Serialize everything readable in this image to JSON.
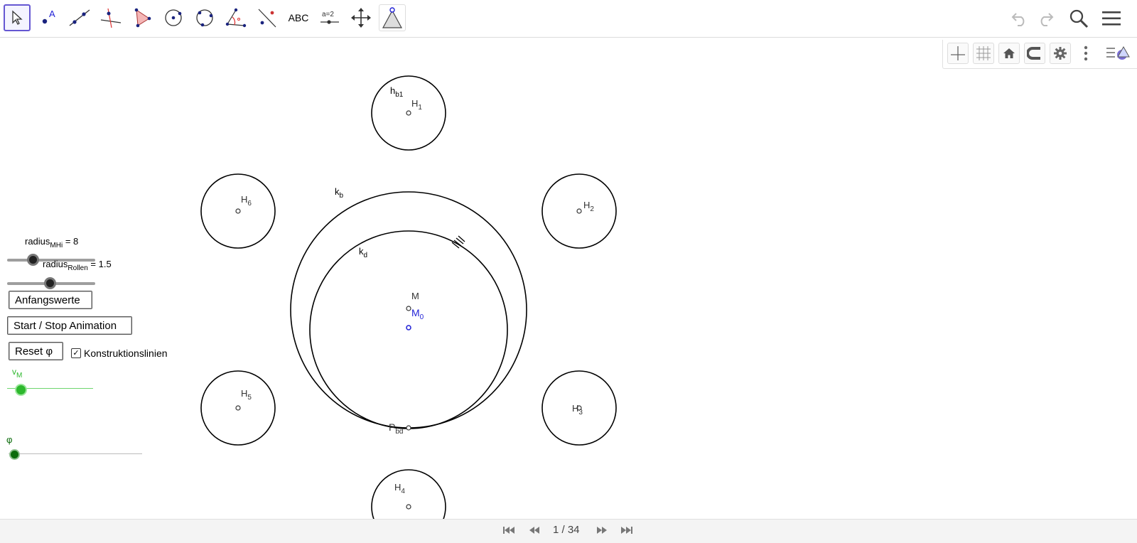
{
  "toolbar": {
    "tools": [
      {
        "name": "move-tool",
        "icon": "cursor-arrow-icon",
        "selected": true
      },
      {
        "name": "point-tool",
        "icon": "point-a-icon",
        "text": "A"
      },
      {
        "name": "line-tool",
        "icon": "line-through-points-icon"
      },
      {
        "name": "perpendicular-tool",
        "icon": "perpendicular-line-icon"
      },
      {
        "name": "polygon-tool",
        "icon": "polygon-icon"
      },
      {
        "name": "circle-center-tool",
        "icon": "circle-center-point-icon"
      },
      {
        "name": "circle-three-points-tool",
        "icon": "circle-three-points-icon"
      },
      {
        "name": "angle-tool",
        "icon": "angle-icon"
      },
      {
        "name": "reflect-tool",
        "icon": "reflect-about-line-icon"
      },
      {
        "name": "text-tool",
        "icon": "text-abc-icon",
        "text": "ABC"
      },
      {
        "name": "slider-tool",
        "icon": "slider-icon",
        "text": "a=2"
      },
      {
        "name": "move-graphics-tool",
        "icon": "move-graphics-icon"
      },
      {
        "name": "custom-tool",
        "icon": "triangle-tool-icon"
      }
    ],
    "right": [
      "undo-icon",
      "redo-icon",
      "search-icon",
      "menu-icon"
    ]
  },
  "graphics_bar": [
    "axes-icon",
    "grid-icon",
    "home-icon",
    "magnet-icon",
    "gear-icon",
    "more-vertical-icon",
    "style-bar-toggle-icon"
  ],
  "labels": {
    "hb1_main": "h",
    "hb1_sub": "b1",
    "H1_main": "H",
    "H1_sub": "1",
    "H2_main": "H",
    "H2_sub": "2",
    "H3_main": "H",
    "H3_sub": "3",
    "H4_main": "H",
    "H4_sub": "4",
    "H5_main": "H",
    "H5_sub": "5",
    "H6_main": "H",
    "H6_sub": "6",
    "kb_main": "k",
    "kb_sub": "b",
    "kd_main": "k",
    "kd_sub": "d",
    "M": "M",
    "M0_main": "M",
    "M0_sub": "0",
    "Pbd_main": "P",
    "Pbd_sub": "bd"
  },
  "sliders": {
    "radius_mhi": {
      "main": "radius",
      "sub": "MHi",
      "value_text": " = 8",
      "value": 8
    },
    "radius_rollen": {
      "main": "radius",
      "sub": "Rollen",
      "value_text": " = 1.5",
      "value": 1.5
    },
    "vM": {
      "main": "v",
      "sub": "M"
    },
    "phi": {
      "label": "φ"
    }
  },
  "buttons": {
    "anfangswerte": "Anfangswerte",
    "start_stop": "Start / Stop Animation",
    "reset_phi": "Reset φ"
  },
  "checkbox": {
    "label": "Konstruktionslinien",
    "checked": true,
    "mark": "✓"
  },
  "colors": {
    "accent": "#6557d2",
    "point_blue": "#1f1fd6",
    "green": "#2db82d",
    "dark_green": "#0b6b0b"
  },
  "pagination": {
    "text": "1 / 34",
    "first": "⏮",
    "prev": "⏪",
    "next": "⏩",
    "last": "⏭"
  }
}
